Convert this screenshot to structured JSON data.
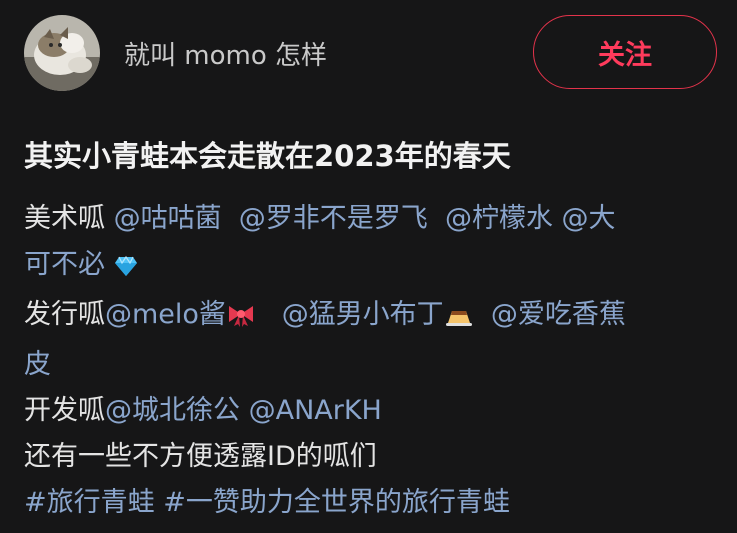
{
  "author": {
    "name": "就叫 momo 怎样",
    "avatar_icon": "cat-avatar"
  },
  "follow_button": {
    "label": "关注"
  },
  "post": {
    "title": "其实小青蛙本会走散在2023年的春天",
    "lines": [
      {
        "prefix": "美术呱 ",
        "mentions": [
          "@咕咕菌",
          "@罗非不是罗飞",
          "@柠檬水",
          "@大"
        ]
      },
      {
        "text": "可不必",
        "emoji": "gem-icon"
      },
      {
        "prefix": "发行呱",
        "mentions": [
          "@melo酱",
          "@猛男小布丁",
          "@爱吃香蕉"
        ],
        "emojis": [
          "ribbon-icon",
          "pudding-icon"
        ]
      },
      {
        "text": "皮"
      },
      {
        "prefix": "开发呱",
        "mentions": [
          "@城北徐公",
          "@ANArKH"
        ]
      },
      {
        "text": "还有一些不方便透露ID的呱们"
      }
    ],
    "hashtags": [
      "#旅行青蛙",
      "#一赞助力全世界的旅行青蛙"
    ]
  },
  "colors": {
    "background": "#161617",
    "accent": "#ff3b5c",
    "mention": "#8aa5cc"
  }
}
